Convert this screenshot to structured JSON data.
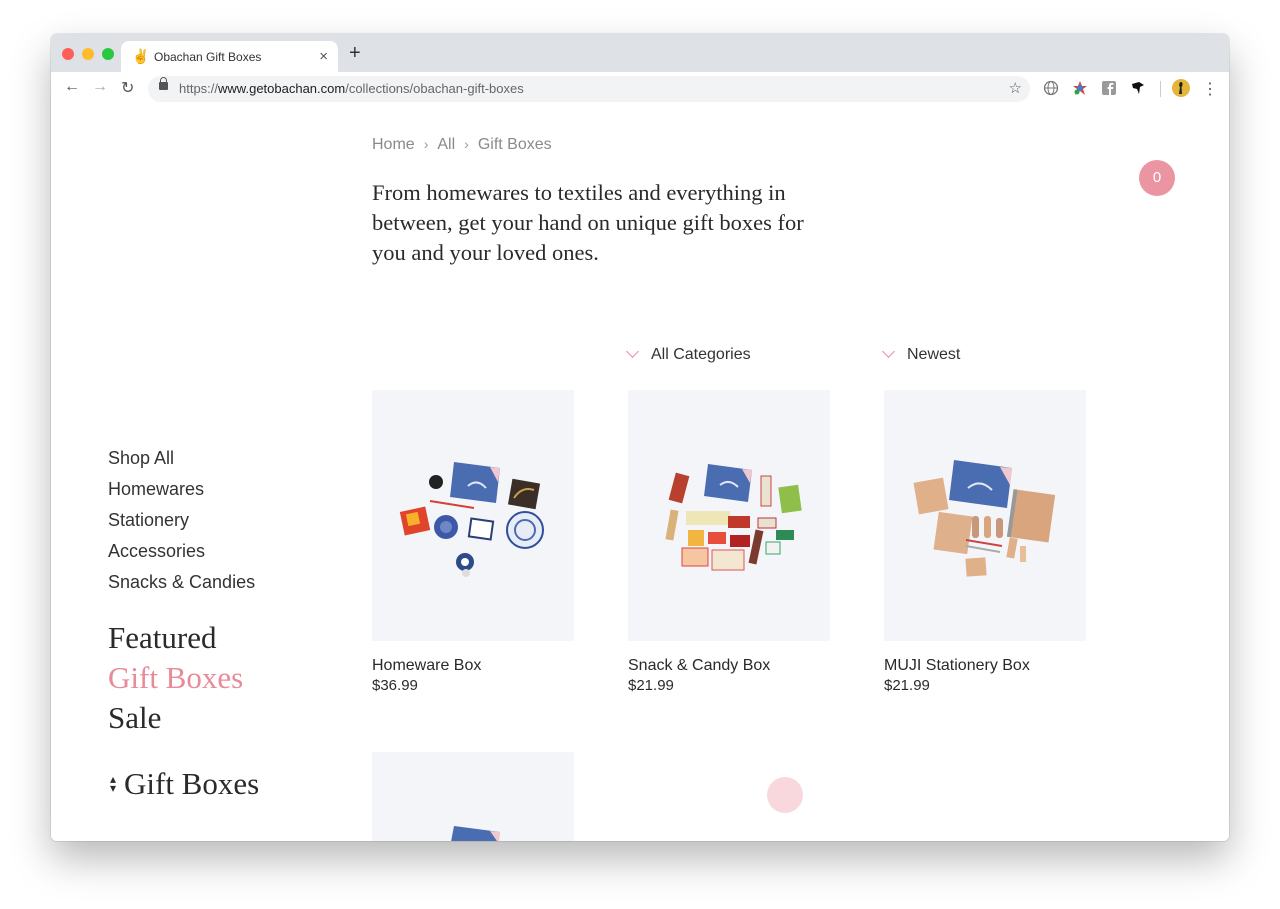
{
  "browser": {
    "tab_title": "Obachan Gift Boxes",
    "tab_icon": "✌",
    "url_prefix": "https://",
    "url_host": "www.getobachan.com",
    "url_path": "/collections/obachan-gift-boxes"
  },
  "breadcrumb": {
    "home": "Home",
    "all": "All",
    "current": "Gift Boxes",
    "separator": "›"
  },
  "intro": "From homewares to textiles and everything in between, get your hand on unique gift boxes for you and your loved ones.",
  "cart": {
    "count": "0"
  },
  "filters": {
    "category": "All Categories",
    "sort": "Newest"
  },
  "sidenav": {
    "items": [
      "Shop All",
      "Homewares",
      "Stationery",
      "Accessories",
      "Snacks & Candies"
    ],
    "featured": "Featured",
    "gift_boxes": "Gift Boxes",
    "sale": "Sale"
  },
  "collection_selector": {
    "label": "Gift Boxes"
  },
  "products": [
    {
      "name": "Homeware Box",
      "price": "$36.99"
    },
    {
      "name": "Snack & Candy Box",
      "price": "$21.99"
    },
    {
      "name": "MUJI Stationery Box",
      "price": "$21.99"
    }
  ],
  "colors": {
    "accent_pink": "#e88a98",
    "box_blue": "#4a6cb0",
    "image_bg": "#f4f5f9"
  }
}
